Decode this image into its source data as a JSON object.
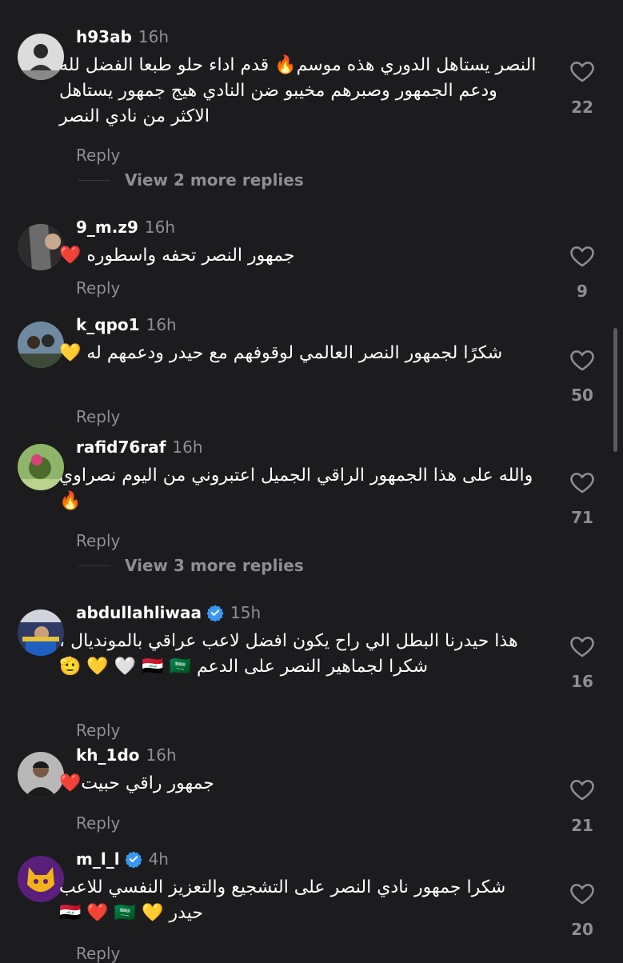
{
  "colors": {
    "background": "#1c1c1e",
    "muted": "#8e8e93",
    "verified": "#3897f0",
    "heart_outline": "#8e8e93"
  },
  "reply_label": "Reply",
  "comments": [
    {
      "username": "h93ab",
      "time": "16h",
      "verified": false,
      "text": "النصر يستاهل الدوري هذه موسم🔥 قدم اداء حلو طبعا الفضل لله ودعم الجمهور وصبرهم مخيبو ضن النادي هيج جمهور يستاهل الاكثر من نادي النصر",
      "likes": "22",
      "more_replies": "View 2 more replies"
    },
    {
      "username": "9_m.z9",
      "time": "16h",
      "verified": false,
      "text": "جمهور النصر تحفه واسطوره ❤️",
      "likes": "9"
    },
    {
      "username": "k_qpo1",
      "time": "16h",
      "verified": false,
      "text": "شكرًا لجمهور النصر العالمي لوقوفهم مع حيدر ودعمهم له 💛",
      "likes": "50"
    },
    {
      "username": "rafid76raf",
      "time": "16h",
      "verified": false,
      "text": "والله على هذا الجمهور الراقي الجميل  اعتبروني من اليوم نصراوي 🔥",
      "likes": "71",
      "more_replies": "View 3 more replies"
    },
    {
      "username": "abdullahliwaa",
      "time": "15h",
      "verified": true,
      "text": "هذا حيدرنا البطل الي راح يكون افضل لاعب عراقي بالمونديال ، شكرا لجماهير النصر على الدعم 🇮🇶 🇸🇦 🤍 💛 🫡",
      "likes": "16"
    },
    {
      "username": "kh_1do",
      "time": "16h",
      "verified": false,
      "text": "جمهور راقي حبيت❤️",
      "likes": "21"
    },
    {
      "username": "m_l_l",
      "time": "4h",
      "verified": true,
      "text": "شكرا جمهور نادي النصر على التشجيع والتعزيز النفسي للاعب حيدر 💛 🇮🇶 ❤️ 🇸🇦",
      "likes": "20"
    }
  ]
}
